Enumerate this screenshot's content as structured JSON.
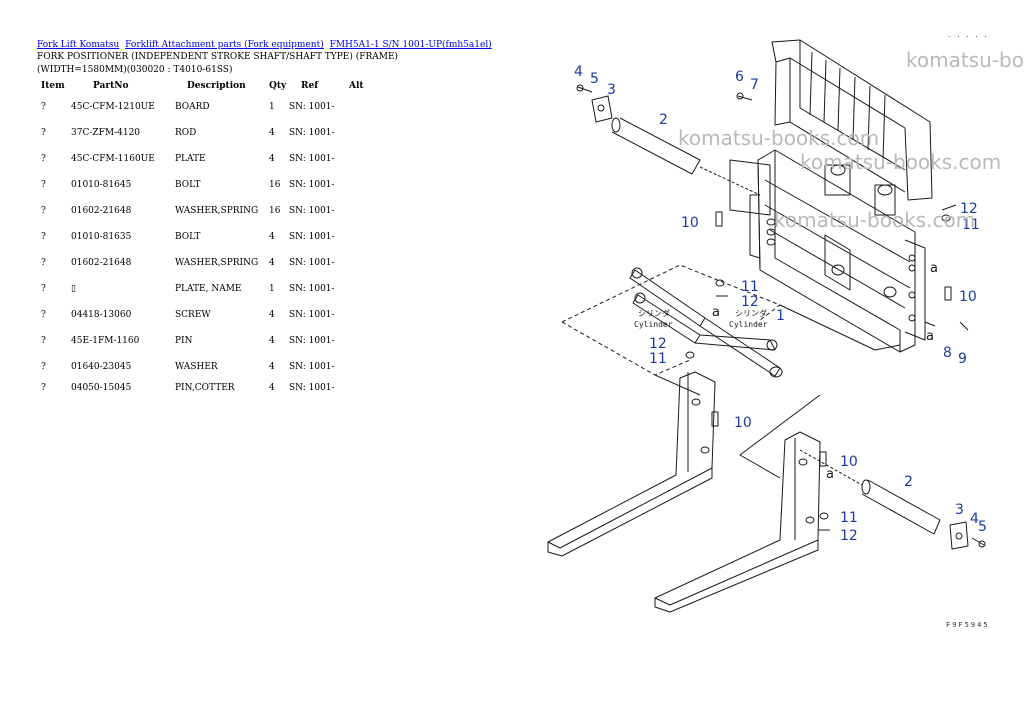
{
  "breadcrumb": [
    {
      "label": "Fork Lift Komatsu"
    },
    {
      "label": "Forklift Attachment parts (Fork equipment)"
    },
    {
      "label": "FMH5A1-1 S/N 1001-UP(fmh5a1el)"
    }
  ],
  "title": "FORK POSITIONER (INDEPENDENT STROKE SHAFT/SHAFT TYPE) (FRAME)",
  "subtitle": "(WIDTH=1580MM)(030020 : T4010-61SS)",
  "table": {
    "headers": [
      "Item",
      "PartNo",
      "Description",
      "Qty",
      "Ref",
      "Alt"
    ],
    "rows": [
      [
        "?",
        "45C-CFM-1210UE",
        "BOARD",
        "1",
        "SN: 1001-",
        ""
      ],
      [
        "?",
        "37C-ZFM-4120",
        "ROD",
        "4",
        "SN: 1001-",
        ""
      ],
      [
        "?",
        "45C-CFM-1160UE",
        "PLATE",
        "4",
        "SN: 1001-",
        ""
      ],
      [
        "?",
        "01010-81645",
        "BOLT",
        "16",
        "SN: 1001-",
        ""
      ],
      [
        "?",
        "01602-21648",
        "WASHER,SPRING",
        "16",
        "SN: 1001-",
        ""
      ],
      [
        "?",
        "01010-81635",
        "BOLT",
        "4",
        "SN: 1001-",
        ""
      ],
      [
        "?",
        "01602-21648",
        "WASHER,SPRING",
        "4",
        "SN: 1001-",
        ""
      ],
      [
        "?",
        "▯",
        "PLATE, NAME",
        "1",
        "SN: 1001-",
        ""
      ],
      [
        "?",
        "04418-13060",
        "SCREW",
        "4",
        "SN: 1001-",
        ""
      ],
      [
        "?",
        "45E-1FM-1160",
        "PIN",
        "4",
        "SN: 1001-",
        ""
      ],
      [
        "?",
        "01640-23045",
        "WASHER",
        "4",
        "SN: 1001-",
        ""
      ],
      [
        "?",
        "04050-15045",
        "PIN,COTTER",
        "4",
        "SN: 1001-",
        ""
      ]
    ]
  },
  "diagram": {
    "watermark": "komatsu-books.com",
    "watermark_top_right": "komatsu-bo",
    "callouts": [
      "1",
      "2",
      "3",
      "4",
      "5",
      "6",
      "7",
      "8",
      "9",
      "10",
      "11",
      "12",
      "2",
      "3",
      "4",
      "5",
      "10",
      "11",
      "12",
      "10",
      "11",
      "12",
      "10",
      "11",
      "12",
      "a",
      "a",
      "a",
      "a",
      "a"
    ],
    "cylinder_label_jp": "シリンダ",
    "cylinder_label_en": "Cylinder",
    "corner_mark": ". . . . .",
    "figure_code": "F9F5945",
    "line_color": "#1a1a1a",
    "callout_color": "#1a3aa0"
  }
}
